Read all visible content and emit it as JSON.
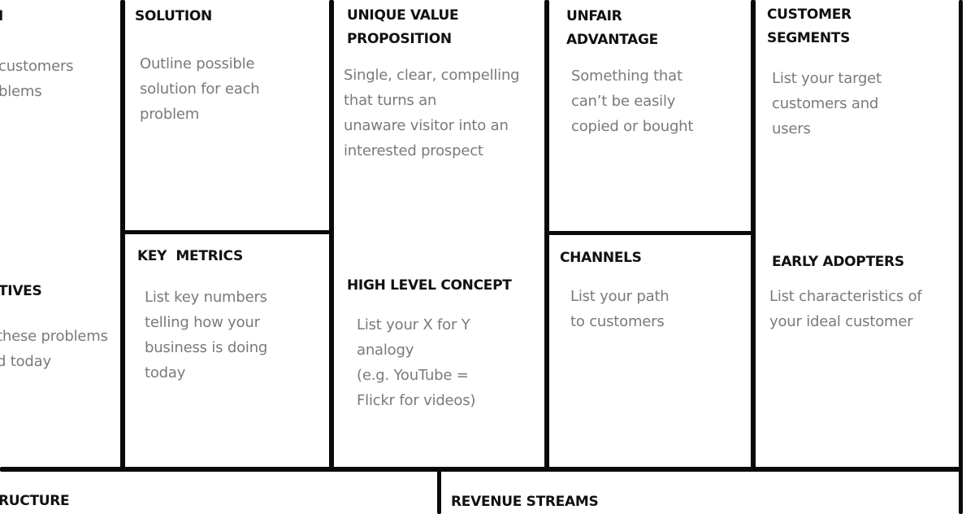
{
  "canvas": {
    "problem": {
      "title_fragment": "N",
      "text_fragment": "customers\nblems"
    },
    "existing_alternatives": {
      "title_fragment": "TIVES",
      "text_fragment": "these problems\nd today"
    },
    "solution": {
      "title": "SOLUTION",
      "text": "Outline possible\nsolution for each\nproblem"
    },
    "key_metrics": {
      "title": "KEY  METRICS",
      "text": "List key numbers\ntelling how your\nbusiness is doing\ntoday"
    },
    "unique_value_proposition": {
      "title": "UNIQUE VALUE\nPROPOSITION",
      "text": "Single, clear, compelling\nthat turns an\nunaware visitor into an\ninterested prospect"
    },
    "high_level_concept": {
      "title": "HIGH LEVEL CONCEPT",
      "text": "List your X for Y\nanalogy\n(e.g. YouTube =\nFlickr for videos)"
    },
    "unfair_advantage": {
      "title": "UNFAIR\nADVANTAGE",
      "text": "Something that\ncan’t be easily\ncopied or bought"
    },
    "channels": {
      "title": "CHANNELS",
      "text": "List your path\nto customers"
    },
    "customer_segments": {
      "title": "CUSTOMER\nSEGMENTS",
      "text": "List your target\ncustomers and\nusers"
    },
    "early_adopters": {
      "title": "EARLY ADOPTERS",
      "text": "List characteristics of\nyour ideal customer"
    },
    "cost_structure": {
      "title_fragment": "RUCTURE"
    },
    "revenue_streams": {
      "title": "REVENUE STREAMS"
    }
  },
  "colors": {
    "lines": "#0a0a0a",
    "heading": "#111111",
    "body_text": "#7a7a7a",
    "background": "#ffffff"
  }
}
